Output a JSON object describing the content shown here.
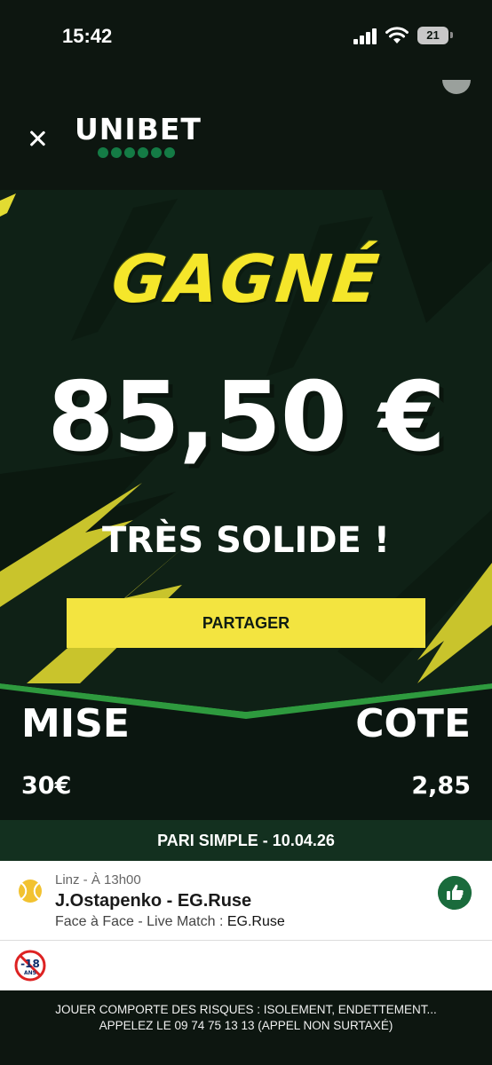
{
  "status_bar": {
    "time": "15:42",
    "battery": "21"
  },
  "header": {
    "close_icon": "close-icon",
    "brand": "UNIBET",
    "brand_color": "#147b45"
  },
  "result": {
    "headline": "GAGNÉ",
    "amount": "85,50 €",
    "tagline": "TRÈS SOLIDE !",
    "share_label": "PARTAGER",
    "accent_color": "#f3e440"
  },
  "stake": {
    "stake_label": "MISE",
    "stake_value": "30€",
    "odds_label": "COTE",
    "odds_value": "2,85"
  },
  "bet_type": "PARI SIMPLE - 10.04.26",
  "bet": {
    "sport_icon": "tennis-ball-icon",
    "location": "Linz - À 13h00",
    "match": "J.Ostapenko - EG.Ruse",
    "market": "Face à Face - Live Match :",
    "pick": "EG.Ruse",
    "status_icon": "thumbs-up-icon"
  },
  "age_notice": {
    "icon": "under-18-forbidden-icon",
    "text": "-18",
    "sub": "ANS"
  },
  "footer": {
    "line1": "JOUER COMPORTE DES RISQUES : ISOLEMENT, ENDETTEMENT...",
    "line2": "APPELEZ LE 09 74 75 13 13 (APPEL NON SURTAXÉ)"
  }
}
